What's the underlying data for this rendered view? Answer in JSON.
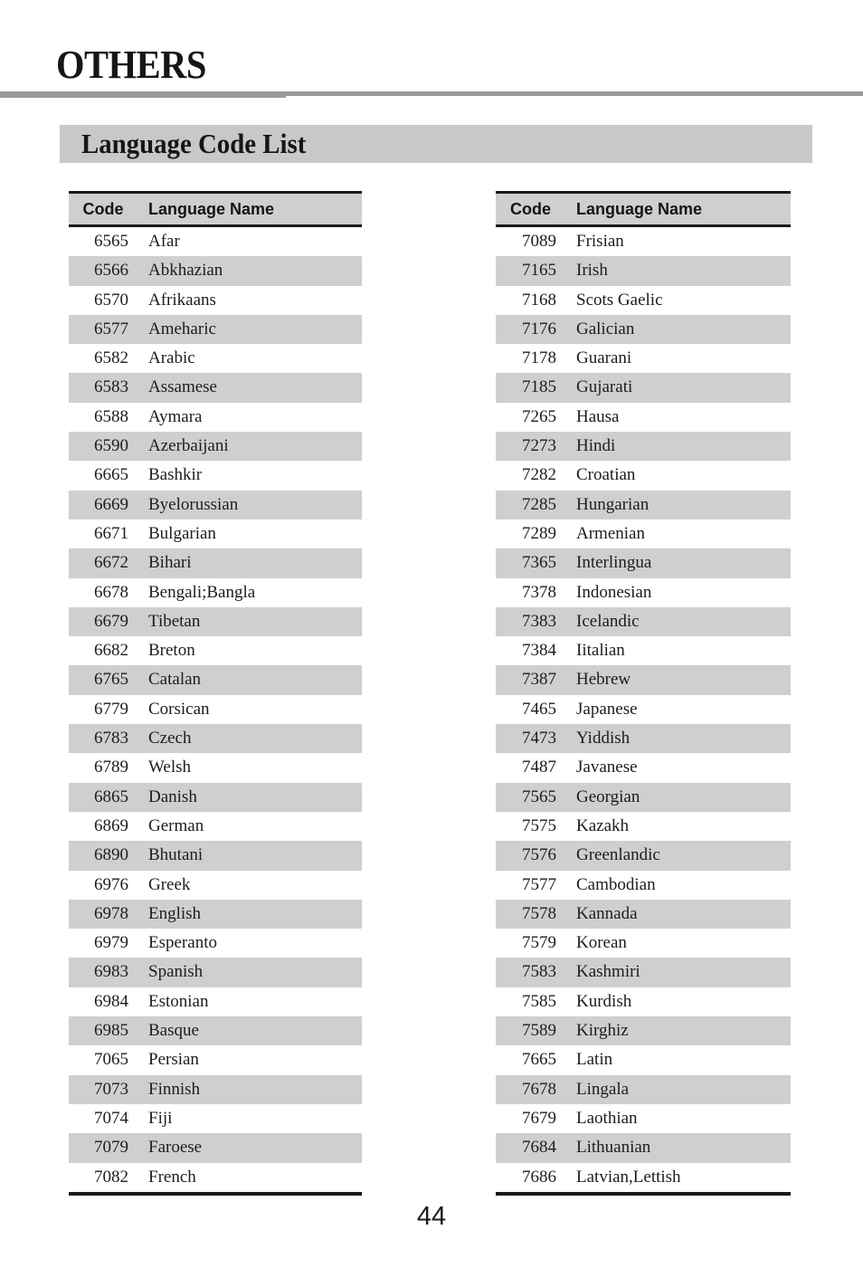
{
  "page": {
    "chapter_title": "OTHERS",
    "section_title": "Language Code List",
    "page_number": "44",
    "colors": {
      "banner_gray": "#c8c8c8",
      "header_row_gray": "#cfcfcf",
      "shaded_row_gray": "#cfcfcf",
      "rule_gray": "#9a9a9a",
      "ink": "#1a1a1a",
      "paper": "#ffffff"
    }
  },
  "tables": [
    {
      "id": "left",
      "columns": [
        "Code",
        "Language Name"
      ],
      "rows": [
        {
          "code": "6565",
          "name": "Afar"
        },
        {
          "code": "6566",
          "name": "Abkhazian"
        },
        {
          "code": "6570",
          "name": "Afrikaans"
        },
        {
          "code": "6577",
          "name": "Ameharic"
        },
        {
          "code": "6582",
          "name": "Arabic"
        },
        {
          "code": "6583",
          "name": "Assamese"
        },
        {
          "code": "6588",
          "name": "Aymara"
        },
        {
          "code": "6590",
          "name": "Azerbaijani"
        },
        {
          "code": "6665",
          "name": "Bashkir"
        },
        {
          "code": "6669",
          "name": "Byelorussian"
        },
        {
          "code": "6671",
          "name": "Bulgarian"
        },
        {
          "code": "6672",
          "name": "Bihari"
        },
        {
          "code": "6678",
          "name": "Bengali;Bangla"
        },
        {
          "code": "6679",
          "name": "Tibetan"
        },
        {
          "code": "6682",
          "name": "Breton"
        },
        {
          "code": "6765",
          "name": "Catalan"
        },
        {
          "code": "6779",
          "name": "Corsican"
        },
        {
          "code": "6783",
          "name": "Czech"
        },
        {
          "code": "6789",
          "name": "Welsh"
        },
        {
          "code": "6865",
          "name": "Danish"
        },
        {
          "code": "6869",
          "name": "German"
        },
        {
          "code": "6890",
          "name": "Bhutani"
        },
        {
          "code": "6976",
          "name": "Greek"
        },
        {
          "code": "6978",
          "name": "English"
        },
        {
          "code": "6979",
          "name": "Esperanto"
        },
        {
          "code": "6983",
          "name": "Spanish"
        },
        {
          "code": "6984",
          "name": "Estonian"
        },
        {
          "code": "6985",
          "name": "Basque"
        },
        {
          "code": "7065",
          "name": "Persian"
        },
        {
          "code": "7073",
          "name": "Finnish"
        },
        {
          "code": "7074",
          "name": "Fiji"
        },
        {
          "code": "7079",
          "name": "Faroese"
        },
        {
          "code": "7082",
          "name": "French"
        }
      ]
    },
    {
      "id": "right",
      "columns": [
        "Code",
        "Language Name"
      ],
      "rows": [
        {
          "code": "7089",
          "name": "Frisian"
        },
        {
          "code": "7165",
          "name": "Irish"
        },
        {
          "code": "7168",
          "name": "Scots Gaelic"
        },
        {
          "code": "7176",
          "name": "Galician"
        },
        {
          "code": "7178",
          "name": "Guarani"
        },
        {
          "code": "7185",
          "name": "Gujarati"
        },
        {
          "code": "7265",
          "name": "Hausa"
        },
        {
          "code": "7273",
          "name": "Hindi"
        },
        {
          "code": "7282",
          "name": "Croatian"
        },
        {
          "code": "7285",
          "name": "Hungarian"
        },
        {
          "code": "7289",
          "name": "Armenian"
        },
        {
          "code": "7365",
          "name": "Interlingua"
        },
        {
          "code": "7378",
          "name": "Indonesian"
        },
        {
          "code": "7383",
          "name": "Icelandic"
        },
        {
          "code": "7384",
          "name": "Iitalian"
        },
        {
          "code": "7387",
          "name": "Hebrew"
        },
        {
          "code": "7465",
          "name": "Japanese"
        },
        {
          "code": "7473",
          "name": "Yiddish"
        },
        {
          "code": "7487",
          "name": "Javanese"
        },
        {
          "code": "7565",
          "name": "Georgian"
        },
        {
          "code": "7575",
          "name": "Kazakh"
        },
        {
          "code": "7576",
          "name": "Greenlandic"
        },
        {
          "code": "7577",
          "name": "Cambodian"
        },
        {
          "code": "7578",
          "name": "Kannada"
        },
        {
          "code": "7579",
          "name": "Korean"
        },
        {
          "code": "7583",
          "name": "Kashmiri"
        },
        {
          "code": "7585",
          "name": "Kurdish"
        },
        {
          "code": "7589",
          "name": "Kirghiz"
        },
        {
          "code": "7665",
          "name": "Latin"
        },
        {
          "code": "7678",
          "name": "Lingala"
        },
        {
          "code": "7679",
          "name": "Laothian"
        },
        {
          "code": "7684",
          "name": "Lithuanian"
        },
        {
          "code": "7686",
          "name": "Latvian,Lettish"
        }
      ]
    }
  ]
}
